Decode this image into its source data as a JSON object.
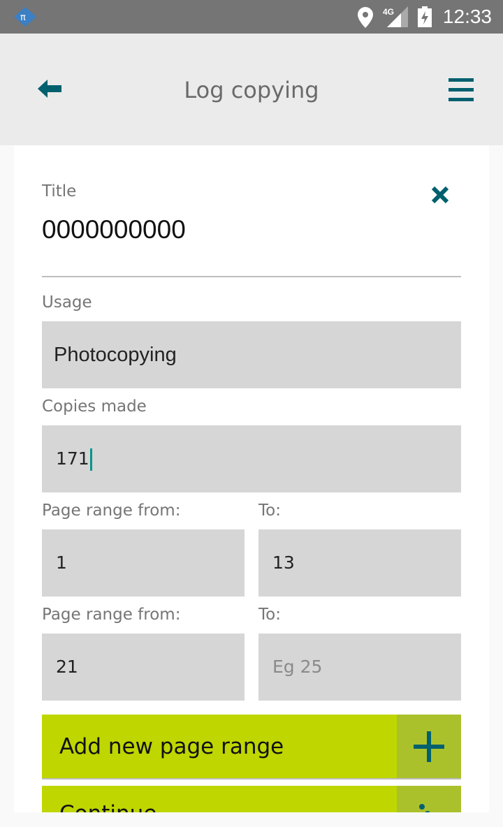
{
  "status_bar": {
    "time": "12:33",
    "network": "4G"
  },
  "header": {
    "title": "Log copying"
  },
  "form": {
    "title_label": "Title",
    "title_value": "0000000000",
    "usage_label": "Usage",
    "usage_value": "Photocopying",
    "copies_label": "Copies made",
    "copies_value": "171",
    "ranges": [
      {
        "from_label": "Page range from:",
        "from_value": "1",
        "to_label": "To:",
        "to_value": "13",
        "to_placeholder": ""
      },
      {
        "from_label": "Page range from:",
        "from_value": "21",
        "to_label": "To:",
        "to_value": "",
        "to_placeholder": "Eg 25"
      }
    ],
    "add_range_label": "Add new page range",
    "continue_label": "Continue"
  },
  "colors": {
    "accent": "#bfd600",
    "icon": "#00606e"
  }
}
